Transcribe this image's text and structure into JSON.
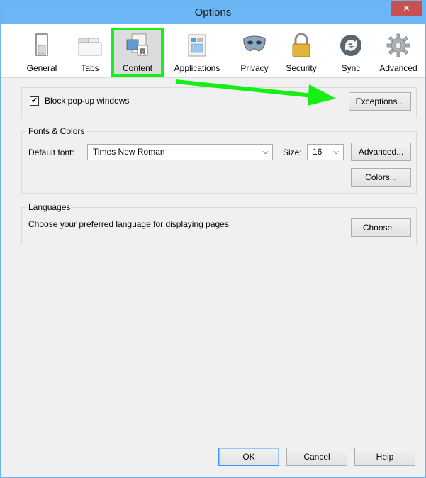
{
  "window": {
    "title": "Options",
    "close_glyph": "×"
  },
  "toolbar": {
    "items": [
      {
        "label": "General",
        "icon": "general-icon"
      },
      {
        "label": "Tabs",
        "icon": "tabs-icon"
      },
      {
        "label": "Content",
        "icon": "content-icon",
        "selected": true
      },
      {
        "label": "Applications",
        "icon": "applications-icon"
      },
      {
        "label": "Privacy",
        "icon": "privacy-mask-icon"
      },
      {
        "label": "Security",
        "icon": "padlock-icon"
      },
      {
        "label": "Sync",
        "icon": "sync-icon"
      },
      {
        "label": "Advanced",
        "icon": "gear-icon"
      }
    ]
  },
  "popup": {
    "checkbox_label": "Block pop-up windows",
    "checked": true,
    "exceptions_button": "Exceptions..."
  },
  "fonts": {
    "legend": "Fonts & Colors",
    "default_font_label": "Default font:",
    "default_font_value": "Times New Roman",
    "size_label": "Size:",
    "size_value": "16",
    "advanced_button": "Advanced...",
    "colors_button": "Colors..."
  },
  "languages": {
    "legend": "Languages",
    "description": "Choose your preferred language for displaying pages",
    "choose_button": "Choose..."
  },
  "footer": {
    "ok": "OK",
    "cancel": "Cancel",
    "help": "Help"
  },
  "colors": {
    "titlebar": "#6db6f5",
    "selection_highlight": "#16ef16",
    "annotation_arrow": "#16ef16",
    "close_button": "#c75050"
  }
}
